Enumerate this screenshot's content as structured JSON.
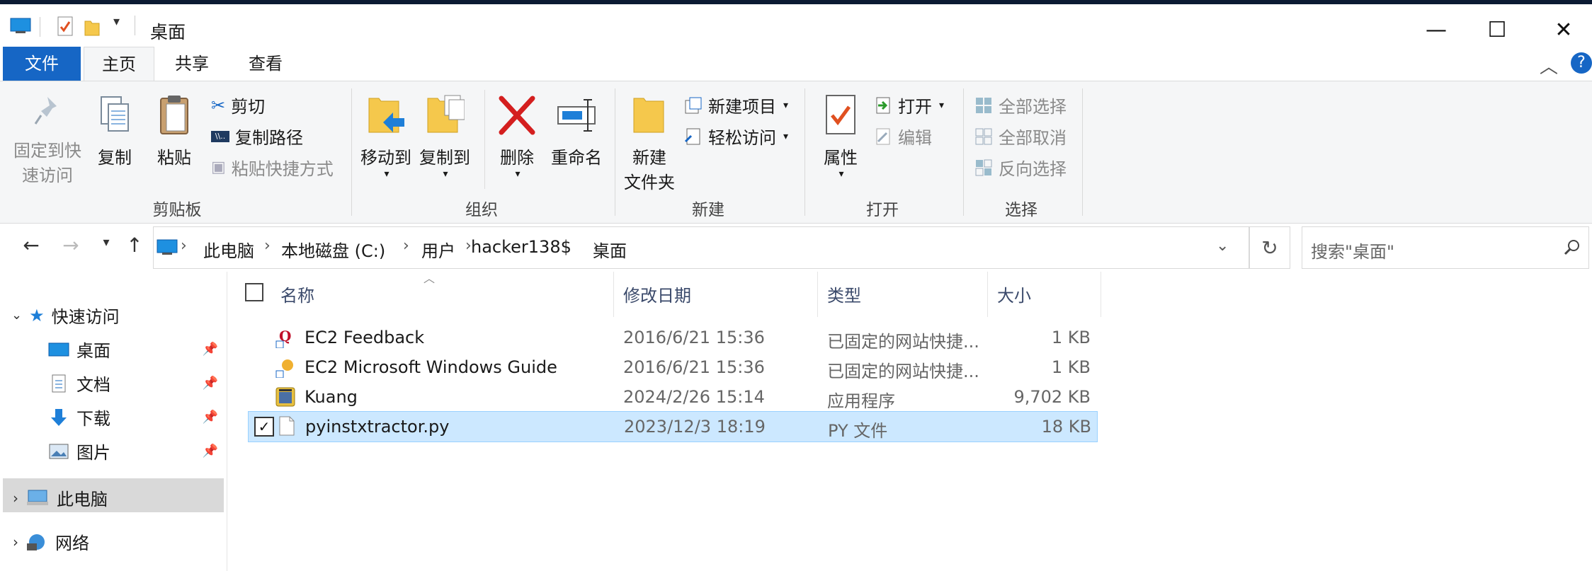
{
  "window": {
    "title": "桌面",
    "minimize": "—",
    "maximize": "☐",
    "close": "✕"
  },
  "ribbon_tabs": [
    "文件",
    "主页",
    "共享",
    "查看"
  ],
  "ribbon": {
    "clipboard": {
      "label": "剪贴板",
      "pin": "固定到快速访问",
      "pin_line1": "固定到快",
      "pin_line2": "速访问",
      "copy": "复制",
      "paste": "粘贴",
      "cut": "剪切",
      "copy_path": "复制路径",
      "paste_shortcut": "粘贴快捷方式"
    },
    "organize": {
      "label": "组织",
      "move_to": "移动到",
      "copy_to": "复制到",
      "delete": "删除",
      "rename": "重命名"
    },
    "new": {
      "label": "新建",
      "new_folder_line1": "新建",
      "new_folder_line2": "文件夹",
      "new_item": "新建项目",
      "easy_access": "轻松访问"
    },
    "open": {
      "label": "打开",
      "properties": "属性",
      "open": "打开",
      "edit": "编辑"
    },
    "select": {
      "label": "选择",
      "select_all": "全部选择",
      "select_none": "全部取消",
      "invert": "反向选择"
    }
  },
  "address": {
    "crumbs": [
      "此电脑",
      "本地磁盘 (C:)",
      "用户",
      "hacker138$",
      "桌面"
    ]
  },
  "search": {
    "placeholder": "搜索\"桌面\""
  },
  "nav": {
    "quick_access": "快速访问",
    "items": [
      {
        "label": "桌面",
        "icon": "desktop-icon"
      },
      {
        "label": "文档",
        "icon": "documents-icon"
      },
      {
        "label": "下载",
        "icon": "downloads-icon"
      },
      {
        "label": "图片",
        "icon": "pictures-icon"
      }
    ],
    "this_pc": "此电脑",
    "network": "网络"
  },
  "columns": {
    "name": "名称",
    "modified": "修改日期",
    "type": "类型",
    "size": "大小"
  },
  "files": [
    {
      "name": "EC2 Feedback",
      "modified": "2016/6/21 15:36",
      "type": "已固定的网站快捷...",
      "size": "1 KB",
      "icon": "web-shortcut-icon"
    },
    {
      "name": "EC2 Microsoft Windows Guide",
      "modified": "2016/6/21 15:36",
      "type": "已固定的网站快捷...",
      "size": "1 KB",
      "icon": "web-shortcut-icon"
    },
    {
      "name": "Kuang",
      "modified": "2024/2/26 15:14",
      "type": "应用程序",
      "size": "9,702 KB",
      "icon": "application-icon"
    },
    {
      "name": "pyinstxtractor.py",
      "modified": "2023/12/3 18:19",
      "type": "PY 文件",
      "size": "18 KB",
      "icon": "file-icon",
      "selected": true
    }
  ]
}
